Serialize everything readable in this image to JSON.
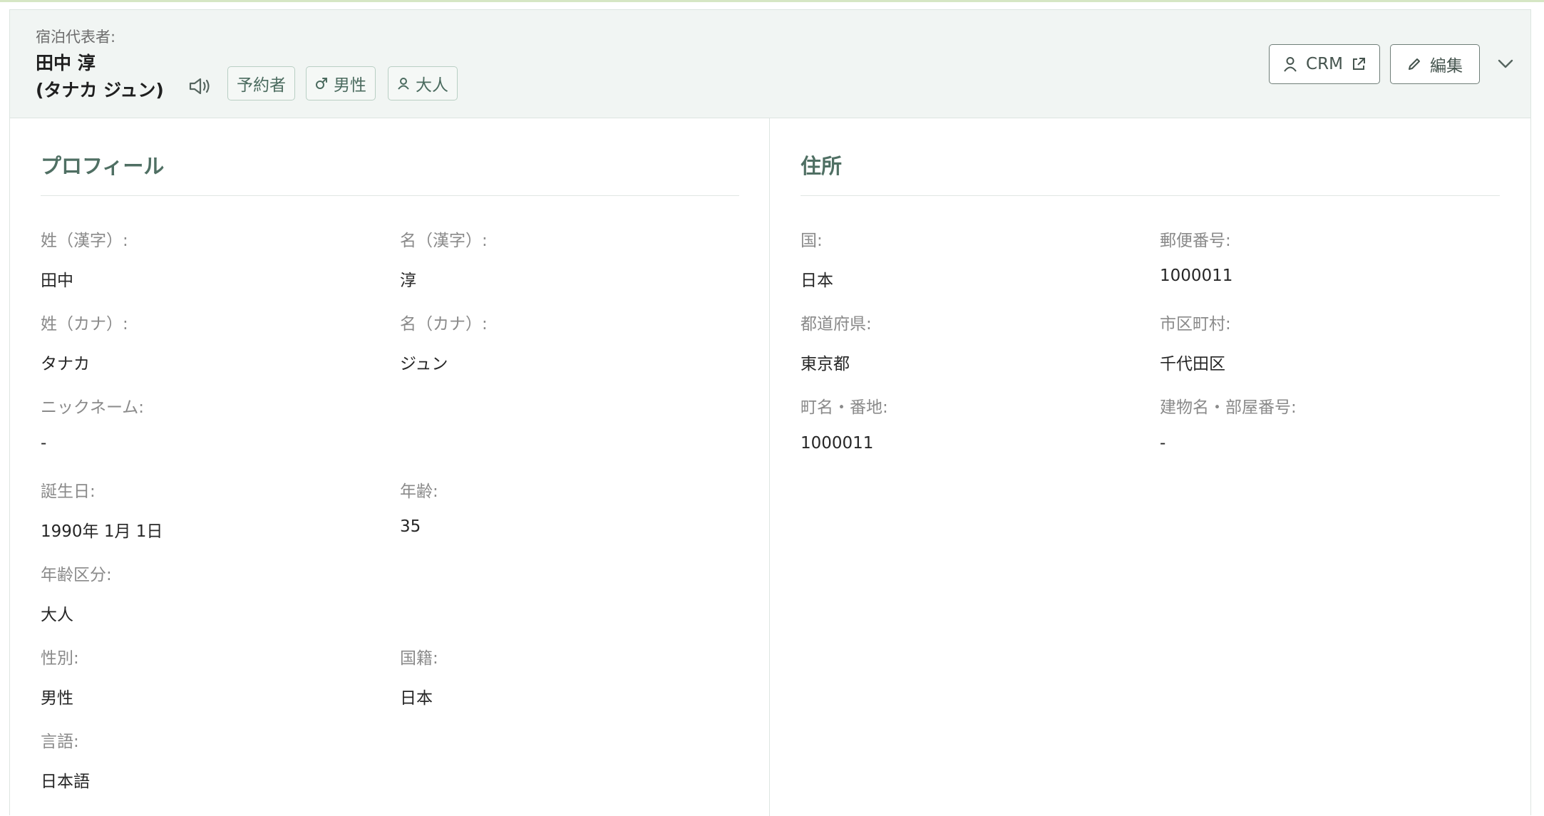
{
  "header": {
    "rep_label": "宿泊代表者:",
    "rep_name_line1": "田中 淳",
    "rep_name_line2": "(タナカ ジュン)",
    "tags": {
      "booker": "予約者",
      "gender": "男性",
      "age_group": "大人"
    },
    "crm_label": "CRM",
    "edit_label": "編集"
  },
  "profile": {
    "title": "プロフィール",
    "last_name_kanji_label": "姓（漢字）:",
    "last_name_kanji": "田中",
    "first_name_kanji_label": "名（漢字）:",
    "first_name_kanji": "淳",
    "last_name_kana_label": "姓（カナ）:",
    "last_name_kana": "タナカ",
    "first_name_kana_label": "名（カナ）:",
    "first_name_kana": "ジュン",
    "nickname_label": "ニックネーム:",
    "nickname": "-",
    "birthday_label": "誕生日:",
    "birthday": "1990年 1月 1日",
    "age_label": "年齢:",
    "age": "35",
    "age_group_label": "年齢区分:",
    "age_group": "大人",
    "gender_label": "性別:",
    "gender": "男性",
    "nationality_label": "国籍:",
    "nationality": "日本",
    "language_label": "言語:",
    "language": "日本語"
  },
  "address": {
    "title": "住所",
    "country_label": "国:",
    "country": "日本",
    "postal_code_label": "郵便番号:",
    "postal_code": "1000011",
    "prefecture_label": "都道府県:",
    "prefecture": "東京都",
    "city_label": "市区町村:",
    "city": "千代田区",
    "street_label": "町名・番地:",
    "street": "1000011",
    "building_label": "建物名・部屋番号:",
    "building": "-"
  },
  "colors": {
    "header_bg": "#f1f5f3",
    "accent_green": "#4f6f63",
    "tag_border": "#b9cfc4"
  },
  "icons": {
    "speaker": "speaker-icon",
    "gender": "male-symbol-icon",
    "person": "person-icon",
    "external": "external-link-icon",
    "pencil": "pencil-icon",
    "chevron": "chevron-down-icon"
  }
}
